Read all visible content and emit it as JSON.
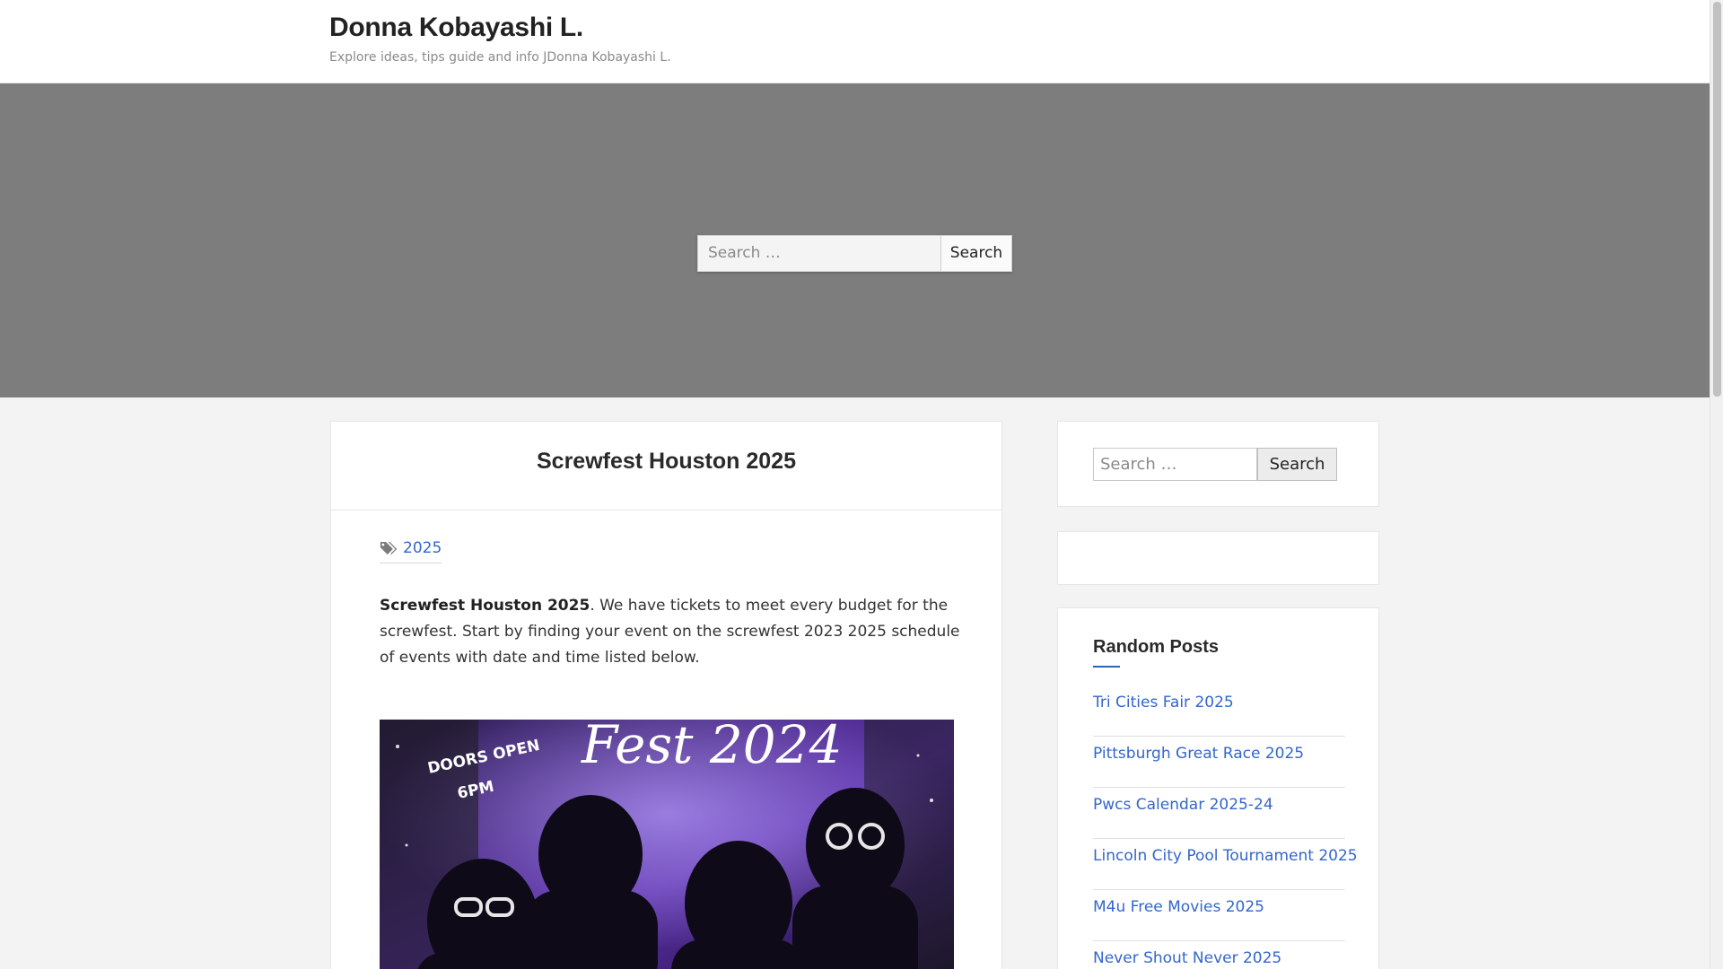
{
  "site": {
    "title": "Donna Kobayashi L.",
    "description": "Explore ideas, tips guide and info JDonna Kobayashi L."
  },
  "hero_search": {
    "placeholder": "Search …",
    "button": "Search"
  },
  "article": {
    "title": "Screwfest Houston 2025",
    "tag": "2025",
    "intro_bold": "Screwfest Houston 2025",
    "intro_rest": ". We have tickets to meet every budget for the screwfest. Start by finding your event on the screwfest 2023 2025 schedule of events with date and time listed below.",
    "poster": {
      "headline": "Fest 2024",
      "doors_line1": "DOORS OPEN",
      "doors_line2": "6PM"
    }
  },
  "sidebar": {
    "search": {
      "placeholder": "Search …",
      "button": "Search"
    },
    "random_posts": {
      "title": "Random Posts",
      "items": [
        "Tri Cities Fair 2025",
        "Pittsburgh Great Race 2025",
        "Pwcs Calendar 2025-24",
        "Lincoln City Pool Tournament 2025",
        "M4u Free Movies 2025",
        "Never Shout Never 2025"
      ]
    }
  },
  "colors": {
    "hero_bg": "#7d7d7d",
    "link": "#3366cc",
    "accent": "#2a64b8"
  }
}
